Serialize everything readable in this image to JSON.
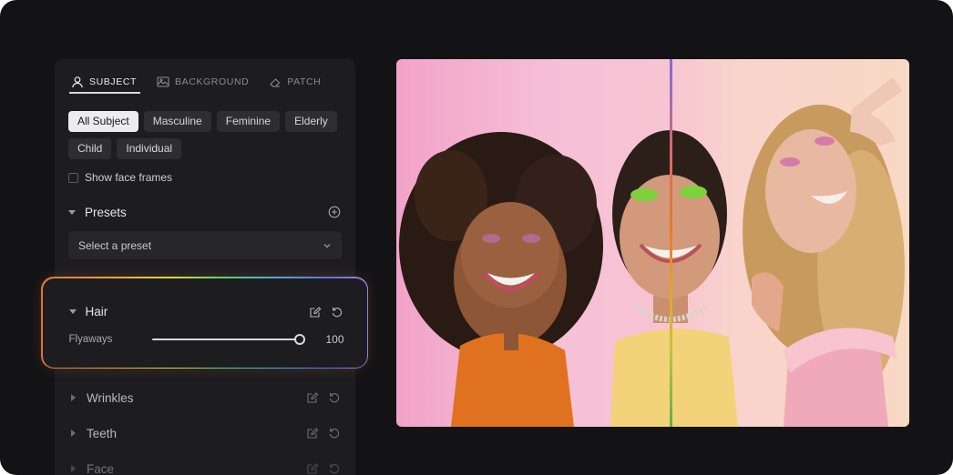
{
  "tabs": [
    {
      "label": "SUBJECT",
      "icon": "user-icon"
    },
    {
      "label": "BACKGROUND",
      "icon": "landscape-icon"
    },
    {
      "label": "PATCH",
      "icon": "eraser-icon"
    }
  ],
  "filters": [
    "All Subject",
    "Masculine",
    "Feminine",
    "Elderly",
    "Child",
    "Individual"
  ],
  "active_filter": "All Subject",
  "show_face_frames": {
    "label": "Show face frames",
    "checked": false
  },
  "presets": {
    "title": "Presets",
    "select_placeholder": "Select a preset"
  },
  "hair": {
    "title": "Hair",
    "slider": {
      "label": "Flyaways",
      "value": "100",
      "fraction": 1.0
    }
  },
  "sections": [
    "Wrinkles",
    "Teeth",
    "Face"
  ],
  "colors": {
    "frame_bg": "#131315",
    "panel_bg": "#1d1d20",
    "chip_bg": "#2e2e32",
    "chip_active_bg": "#ececef"
  }
}
